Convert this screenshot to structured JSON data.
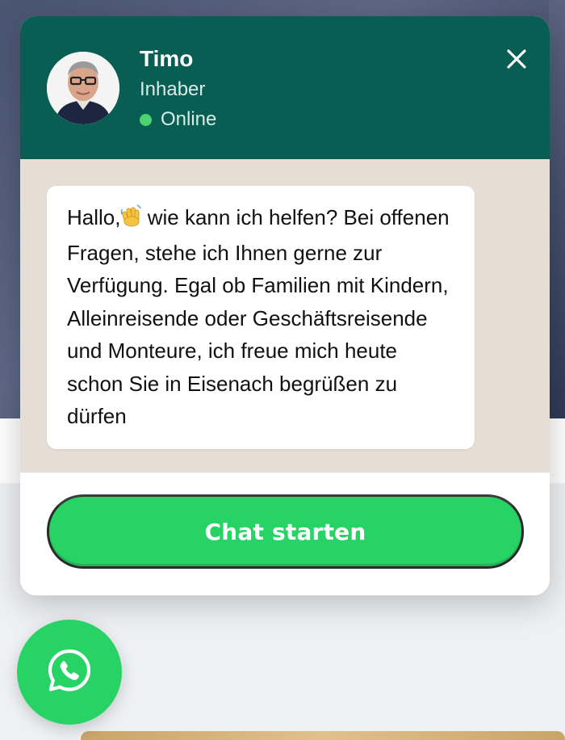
{
  "agent": {
    "name": "Timo",
    "role": "Inhaber",
    "status": "Online"
  },
  "message": {
    "greeting": "Hallo,",
    "emoji": "waving-hand-icon",
    "text": " wie kann ich helfen? Bei offenen Fragen, stehe ich Ihnen gerne zur Verfügung. Egal ob Familien mit Kindern, Alleinreisende oder Geschäftsreisende und Monteure, ich freue mich heute schon Sie in Eisenach begrüßen zu dürfen"
  },
  "actions": {
    "start_label": "Chat starten"
  },
  "icons": {
    "close": "close-icon",
    "fab": "whatsapp-icon",
    "status": "online-dot-icon"
  },
  "colors": {
    "header": "#095e54",
    "chat_background": "#e6ddd5",
    "accent_green": "#28d366",
    "online": "#4ad36f"
  }
}
